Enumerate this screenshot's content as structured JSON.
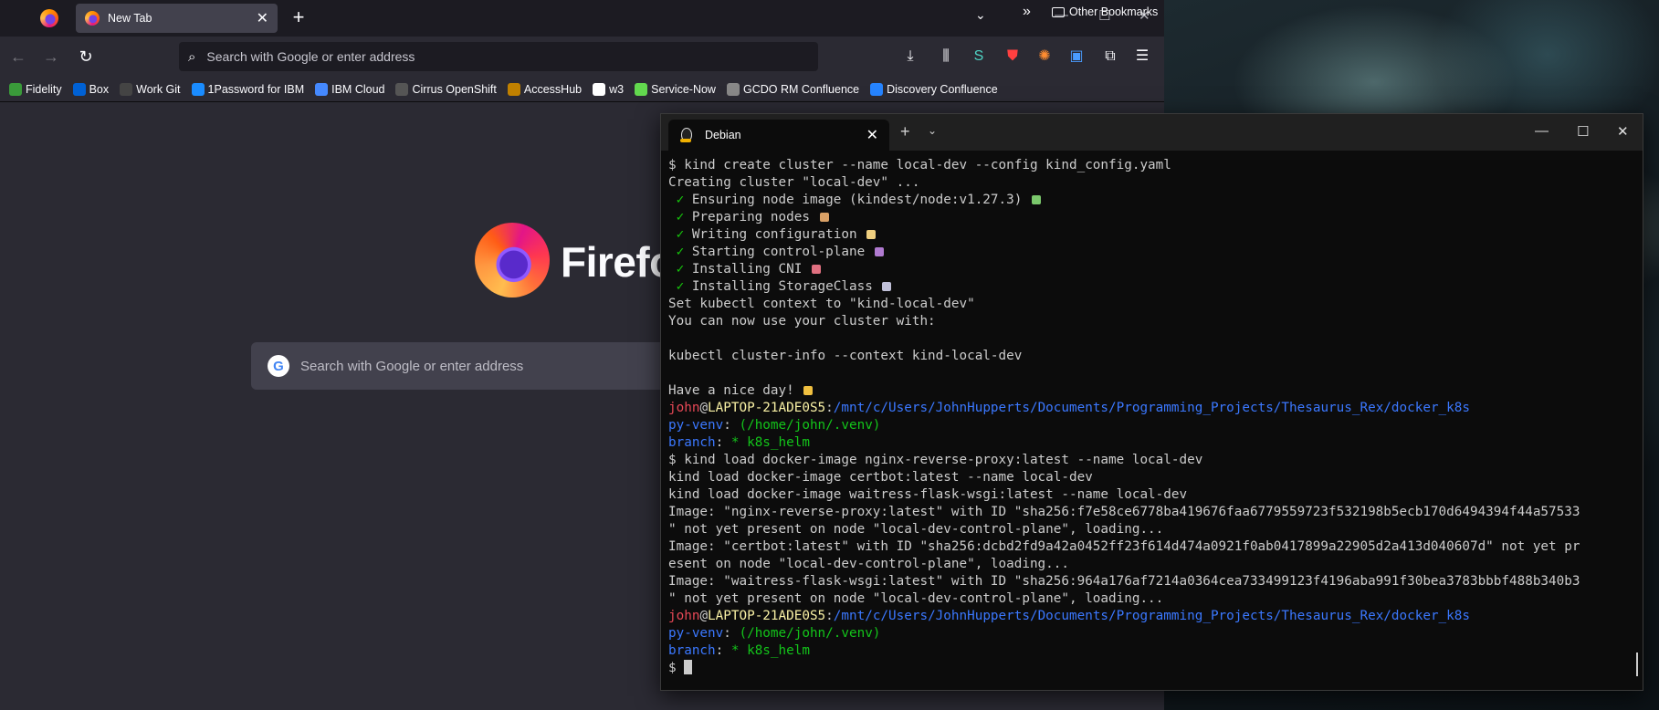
{
  "browser": {
    "tab": {
      "title": "New Tab"
    },
    "urlbar": {
      "placeholder": "Search with Google or enter address"
    },
    "bookmarks": [
      {
        "label": "Fidelity",
        "icon": "fidelity-icon",
        "color": "#3a9a3a"
      },
      {
        "label": "Box",
        "icon": "box-icon",
        "color": "#0061d5"
      },
      {
        "label": "Work Git",
        "icon": "github-icon",
        "color": "#444444"
      },
      {
        "label": "1Password for IBM",
        "icon": "1password-icon",
        "color": "#1a8cff"
      },
      {
        "label": "IBM Cloud",
        "icon": "ibm-cloud-icon",
        "color": "#4589ff"
      },
      {
        "label": "Cirrus OpenShift",
        "icon": "cirrus-icon",
        "color": "#555555"
      },
      {
        "label": "AccessHub",
        "icon": "accesshub-icon",
        "color": "#c08000"
      },
      {
        "label": "w3",
        "icon": "w3-icon",
        "color": "#ffffff"
      },
      {
        "label": "Service-Now",
        "icon": "servicenow-icon",
        "color": "#62d84e"
      },
      {
        "label": "GCDO RM Confluence",
        "icon": "globe-icon",
        "color": "#888888"
      },
      {
        "label": "Discovery Confluence",
        "icon": "confluence-icon",
        "color": "#2684ff"
      }
    ],
    "other_bookmarks": "Other Bookmarks",
    "newtab": {
      "wordmark": "Firefox",
      "search_placeholder": "Search with Google or enter address",
      "google_letter": "G"
    }
  },
  "terminal": {
    "tab_title": "Debian",
    "lines": [
      [
        {
          "t": "$ ",
          "c": ""
        },
        {
          "t": "kind create cluster --name local-dev --config kind_config.yaml",
          "c": ""
        }
      ],
      [
        {
          "t": "Creating cluster \"local-dev\" ...",
          "c": ""
        }
      ],
      [
        {
          "t": " ✓",
          "c": "c-check"
        },
        {
          "t": " Ensuring node image (kindest/node:v1.27.3) ",
          "c": ""
        },
        {
          "e": "#7bc86c"
        }
      ],
      [
        {
          "t": " ✓",
          "c": "c-check"
        },
        {
          "t": " Preparing nodes ",
          "c": ""
        },
        {
          "e": "#d9a066"
        }
      ],
      [
        {
          "t": " ✓",
          "c": "c-check"
        },
        {
          "t": " Writing configuration ",
          "c": ""
        },
        {
          "e": "#f0d080"
        }
      ],
      [
        {
          "t": " ✓",
          "c": "c-check"
        },
        {
          "t": " Starting control-plane ",
          "c": ""
        },
        {
          "e": "#b07ad0"
        }
      ],
      [
        {
          "t": " ✓",
          "c": "c-check"
        },
        {
          "t": " Installing CNI ",
          "c": ""
        },
        {
          "e": "#e07080"
        }
      ],
      [
        {
          "t": " ✓",
          "c": "c-check"
        },
        {
          "t": " Installing StorageClass ",
          "c": ""
        },
        {
          "e": "#c0c0d8"
        }
      ],
      [
        {
          "t": "Set kubectl context to \"kind-local-dev\"",
          "c": ""
        }
      ],
      [
        {
          "t": "You can now use your cluster with:",
          "c": ""
        }
      ],
      [
        {
          "t": "",
          "c": ""
        }
      ],
      [
        {
          "t": "kubectl cluster-info --context kind-local-dev",
          "c": ""
        }
      ],
      [
        {
          "t": "",
          "c": ""
        }
      ],
      [
        {
          "t": "Have a nice day! ",
          "c": ""
        },
        {
          "e": "#f0c040"
        }
      ],
      [
        {
          "t": "john",
          "c": "c-red"
        },
        {
          "t": "@",
          "c": ""
        },
        {
          "t": "LAPTOP-21ADE0S5",
          "c": "c-yellow"
        },
        {
          "t": ":",
          "c": ""
        },
        {
          "t": "/mnt/c/Users/JohnHupperts/Documents/Programming_Projects/Thesaurus_Rex/docker_k8s",
          "c": "c-blue"
        }
      ],
      [
        {
          "t": "py-venv",
          "c": "c-blue"
        },
        {
          "t": ": ",
          "c": ""
        },
        {
          "t": "(/home/john/.venv)",
          "c": "c-green"
        }
      ],
      [
        {
          "t": "branch",
          "c": "c-blue"
        },
        {
          "t": ": ",
          "c": ""
        },
        {
          "t": "* k8s_helm",
          "c": "c-green"
        }
      ],
      [
        {
          "t": "$ kind load docker-image nginx-reverse-proxy:latest --name local-dev",
          "c": ""
        }
      ],
      [
        {
          "t": "kind load docker-image certbot:latest --name local-dev",
          "c": ""
        }
      ],
      [
        {
          "t": "kind load docker-image waitress-flask-wsgi:latest --name local-dev",
          "c": ""
        }
      ],
      [
        {
          "t": "Image: \"nginx-reverse-proxy:latest\" with ID \"sha256:f7e58ce6778ba419676faa6779559723f532198b5ecb170d6494394f44a57533",
          "c": ""
        }
      ],
      [
        {
          "t": "\" not yet present on node \"local-dev-control-plane\", loading...",
          "c": ""
        }
      ],
      [
        {
          "t": "Image: \"certbot:latest\" with ID \"sha256:dcbd2fd9a42a0452ff23f614d474a0921f0ab0417899a22905d2a413d040607d\" not yet pr",
          "c": ""
        }
      ],
      [
        {
          "t": "esent on node \"local-dev-control-plane\", loading...",
          "c": ""
        }
      ],
      [
        {
          "t": "Image: \"waitress-flask-wsgi:latest\" with ID \"sha256:964a176af7214a0364cea733499123f4196aba991f30bea3783bbbf488b340b3",
          "c": ""
        }
      ],
      [
        {
          "t": "\" not yet present on node \"local-dev-control-plane\", loading...",
          "c": ""
        }
      ],
      [
        {
          "t": "john",
          "c": "c-red"
        },
        {
          "t": "@",
          "c": ""
        },
        {
          "t": "LAPTOP-21ADE0S5",
          "c": "c-yellow"
        },
        {
          "t": ":",
          "c": ""
        },
        {
          "t": "/mnt/c/Users/JohnHupperts/Documents/Programming_Projects/Thesaurus_Rex/docker_k8s",
          "c": "c-blue"
        }
      ],
      [
        {
          "t": "py-venv",
          "c": "c-blue"
        },
        {
          "t": ": ",
          "c": ""
        },
        {
          "t": "(/home/john/.venv)",
          "c": "c-green"
        }
      ],
      [
        {
          "t": "branch",
          "c": "c-blue"
        },
        {
          "t": ": ",
          "c": ""
        },
        {
          "t": "* k8s_helm",
          "c": "c-green"
        }
      ],
      [
        {
          "t": "$ ",
          "c": ""
        },
        {
          "cursor": true
        }
      ]
    ]
  }
}
